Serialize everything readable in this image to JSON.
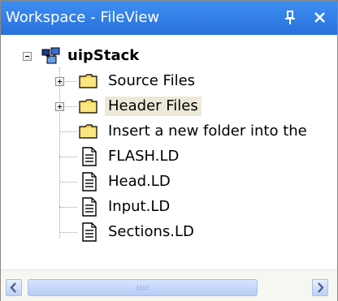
{
  "window": {
    "title": "Workspace - FileView",
    "pin_icon": "pin-icon",
    "close_icon": "close-icon",
    "titlebar_color": "#2a70dc"
  },
  "tree": {
    "root": {
      "label": "uipStack",
      "icon": "workspace-project-icon",
      "expanded": true
    },
    "items": [
      {
        "label": "Source Files",
        "icon": "folder-icon",
        "expandable": true,
        "selected": false
      },
      {
        "label": "Header Files",
        "icon": "folder-icon",
        "expandable": true,
        "selected": true
      },
      {
        "label": "Insert a new folder into the",
        "icon": "folder-icon",
        "expandable": false,
        "selected": false
      },
      {
        "label": "FLASH.LD",
        "icon": "document-icon",
        "expandable": false,
        "selected": false
      },
      {
        "label": "Head.LD",
        "icon": "document-icon",
        "expandable": false,
        "selected": false
      },
      {
        "label": "Input.LD",
        "icon": "document-icon",
        "expandable": false,
        "selected": false
      },
      {
        "label": "Sections.LD",
        "icon": "document-icon",
        "expandable": false,
        "selected": false
      }
    ]
  },
  "scrollbar": {
    "orientation": "horizontal",
    "left_icon": "chevron-left-icon",
    "right_icon": "chevron-right-icon"
  }
}
